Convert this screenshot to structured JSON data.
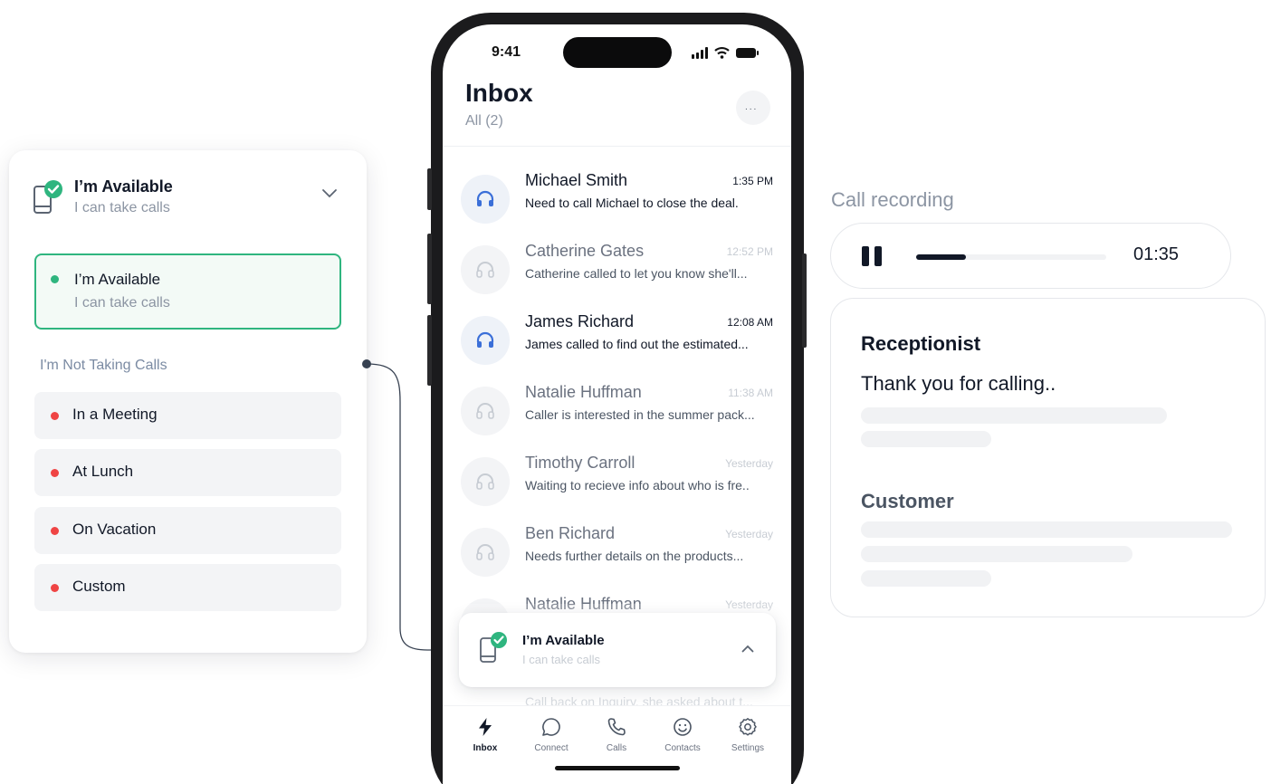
{
  "status_card": {
    "current_title": "I’m Available",
    "current_subtitle": "I can take calls",
    "selected_option": {
      "title": "I’m Available",
      "subtitle": "I can take calls"
    },
    "section_label": "I'm Not Taking Calls",
    "options": [
      "In a Meeting",
      "At Lunch",
      "On Vacation",
      "Custom"
    ]
  },
  "phone": {
    "status_bar_time": "9:41",
    "title": "Inbox",
    "filter": "All (2)",
    "more_label": "...",
    "messages": [
      {
        "name": "Michael Smith",
        "time": "1:35 PM",
        "preview": "Need to call Michael to close the deal."
      },
      {
        "name": "Catherine Gates",
        "time": "12:52 PM",
        "preview": "Catherine called to let you know she'll..."
      },
      {
        "name": "James Richard",
        "time": "12:08 AM",
        "preview": "James called to find out the estimated..."
      },
      {
        "name": "Natalie Huffman",
        "time": "11:38 AM",
        "preview": "Caller is interested in the summer pack..."
      },
      {
        "name": "Timothy Carroll",
        "time": "Yesterday",
        "preview": "Waiting to recieve info about who is fre.."
      },
      {
        "name": "Ben Richard",
        "time": "Yesterday",
        "preview": "Needs further details on the products..."
      },
      {
        "name": "Natalie Huffman",
        "time": "Yesterday",
        "preview": ""
      }
    ],
    "under_popup_text": "Call back on Inquiry, she asked about t...",
    "popup": {
      "title": "I’m Available",
      "subtitle": "I can take calls"
    },
    "tabs": [
      "Inbox",
      "Connect",
      "Calls",
      "Contacts",
      "Settings"
    ]
  },
  "recording": {
    "label": "Call recording",
    "time": "01:35",
    "progress": 0.26
  },
  "transcript": {
    "receptionist_label": "Receptionist",
    "receptionist_message": "Thank you for calling..",
    "customer_label": "Customer"
  },
  "colors": {
    "available_green": "#2fb57f",
    "busy_red": "#ef4444",
    "accent_blue": "#3b6fd8"
  }
}
